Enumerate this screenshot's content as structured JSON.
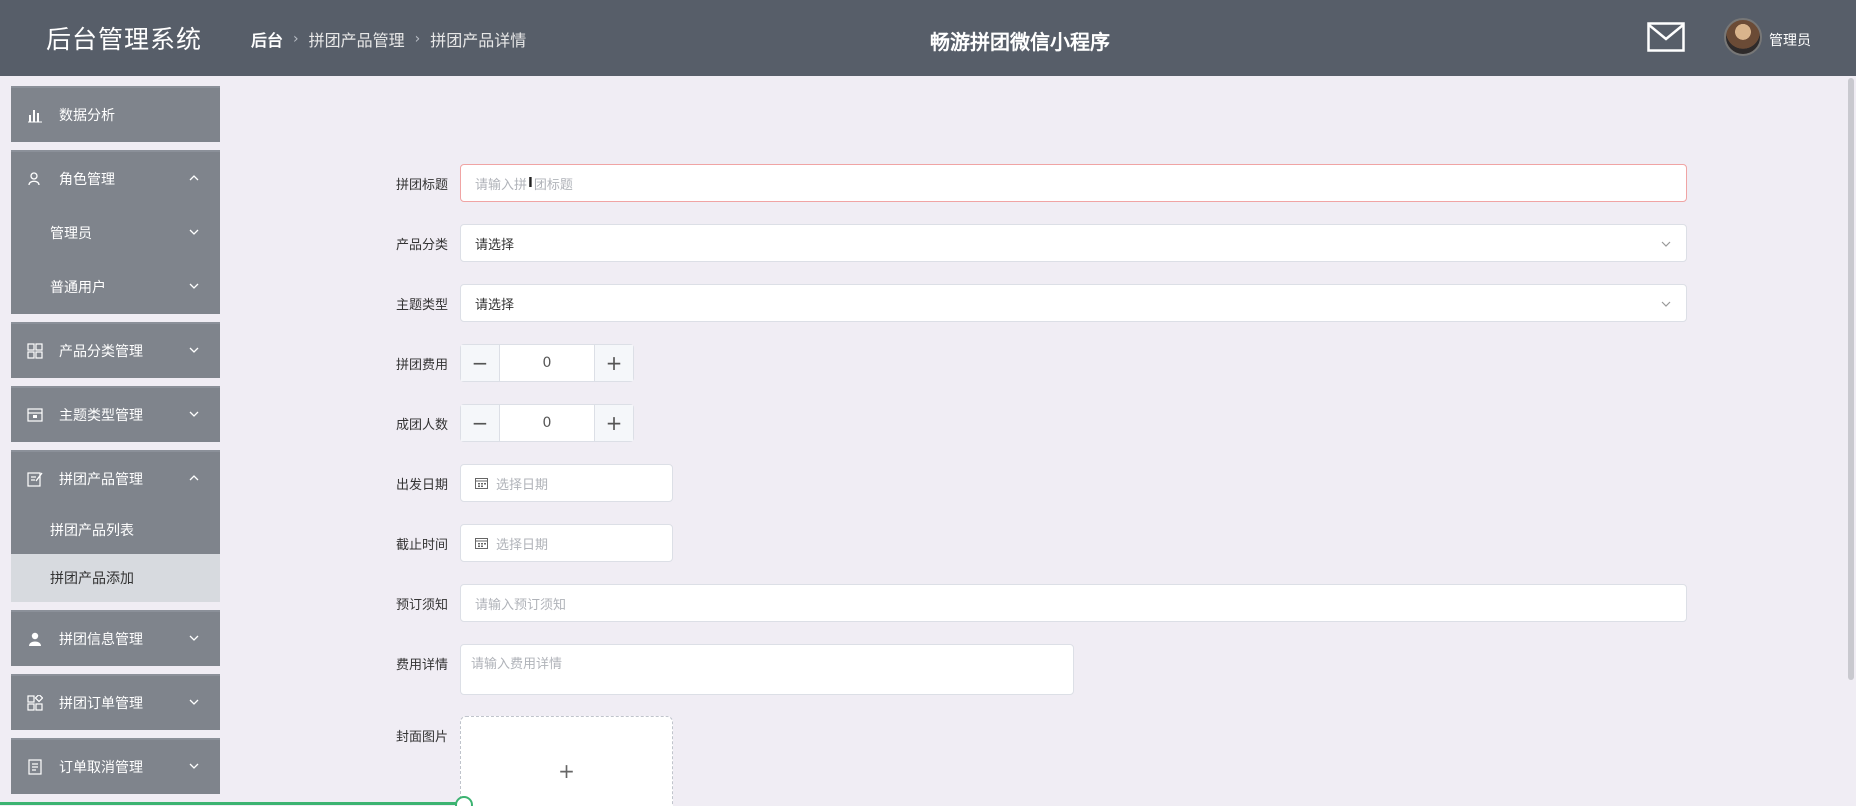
{
  "header": {
    "app_title": "后台管理系统",
    "breadcrumb": [
      "后台",
      "拼团产品管理",
      "拼团产品详情"
    ],
    "center_title": "畅游拼团微信小程序",
    "user_name": "管理员"
  },
  "sidebar": {
    "data_analysis": "数据分析",
    "role_mgmt": "角色管理",
    "admin": "管理员",
    "normal_user": "普通用户",
    "product_category": "产品分类管理",
    "theme_type": "主题类型管理",
    "group_product": "拼团产品管理",
    "group_product_list": "拼团产品列表",
    "group_product_add": "拼团产品添加",
    "group_info": "拼团信息管理",
    "group_order": "拼团订单管理",
    "order_cancel": "订单取消管理"
  },
  "form": {
    "title_label": "拼团标题",
    "title_placeholder_a": "请输入拼",
    "title_placeholder_b": "团标题",
    "category_label": "产品分类",
    "category_value": "请选择",
    "theme_label": "主题类型",
    "theme_value": "请选择",
    "fee_label": "拼团费用",
    "fee_value": "0",
    "people_label": "成团人数",
    "people_value": "0",
    "depart_label": "出发日期",
    "depart_placeholder": "选择日期",
    "deadline_label": "截止时间",
    "deadline_placeholder": "选择日期",
    "notice_label": "预订须知",
    "notice_placeholder": "请输入预订须知",
    "cost_label": "费用详情",
    "cost_placeholder": "请输入费用详情",
    "cover_label": "封面图片",
    "minus": "−",
    "plus": "+"
  },
  "colors": {
    "header_bg": "#575e69",
    "sidebar_item_bg": "#7f848c",
    "selected_bg": "#d7dadf",
    "page_bg": "#f0edf4",
    "focus_border": "#f0a4a4"
  }
}
